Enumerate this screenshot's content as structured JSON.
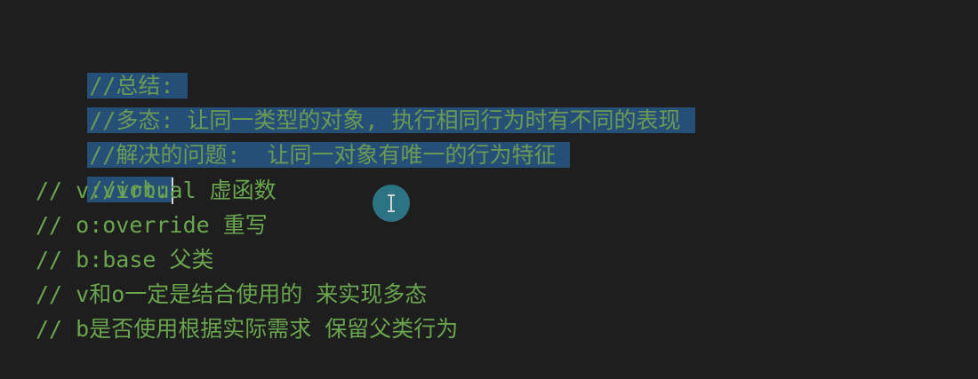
{
  "editor": {
    "lines": [
      "//总结:",
      "//多态: 让同一类型的对象, 执行相同行为时有不同的表现",
      "//解决的问题:  让同一对象有唯一的行为特征",
      "//vob:",
      "// v:virtual 虚函数",
      "// o:override 重写",
      "// b:base 父类",
      "// v和o一定是结合使用的 来实现多态",
      "// b是否使用根据实际需求 保留父类行为"
    ]
  },
  "colors": {
    "background": "#1e1e1e",
    "comment": "#57a64a",
    "selection": "#264f78"
  },
  "cursor_icon": "text-cursor-icon"
}
